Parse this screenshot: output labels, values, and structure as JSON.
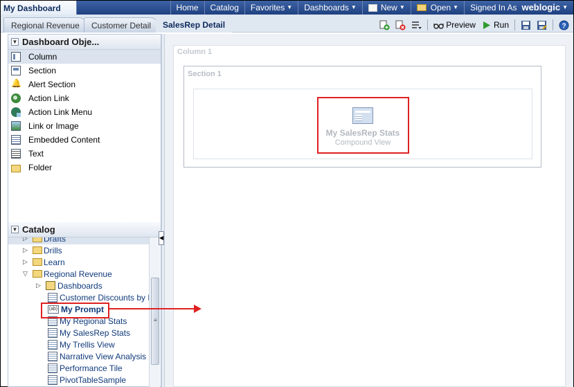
{
  "app": {
    "title": "My Dashboard"
  },
  "top_nav": {
    "home": "Home",
    "catalog": "Catalog",
    "favorites": "Favorites",
    "dashboards": "Dashboards",
    "new": "New",
    "open": "Open",
    "signed_in_as": "Signed In As",
    "user": "weblogic"
  },
  "tabs": [
    {
      "label": "Regional Revenue"
    },
    {
      "label": "Customer Detail"
    },
    {
      "label": "SalesRep Detail",
      "active": true
    }
  ],
  "toolbar": {
    "preview_label": "Preview",
    "run_label": "Run",
    "help_label": "?"
  },
  "dashboard_objects": {
    "header": "Dashboard Obje...",
    "items": [
      {
        "label": "Column",
        "icon": "column-icon"
      },
      {
        "label": "Section",
        "icon": "section-icon"
      },
      {
        "label": "Alert Section",
        "icon": "bell-icon"
      },
      {
        "label": "Action Link",
        "icon": "action-link-icon"
      },
      {
        "label": "Action Link Menu",
        "icon": "action-link-menu-icon"
      },
      {
        "label": "Link or Image",
        "icon": "image-icon"
      },
      {
        "label": "Embedded Content",
        "icon": "embedded-content-icon"
      },
      {
        "label": "Text",
        "icon": "text-icon"
      },
      {
        "label": "Folder",
        "icon": "folder-icon"
      }
    ]
  },
  "catalog": {
    "header": "Catalog",
    "items": [
      {
        "label": "Drafts",
        "type": "folder",
        "expanded": false
      },
      {
        "label": "Drills",
        "type": "folder",
        "expanded": false
      },
      {
        "label": "Learn",
        "type": "folder",
        "expanded": false
      },
      {
        "label": "Regional Revenue",
        "type": "folder",
        "expanded": true
      },
      {
        "label": "Dashboards",
        "type": "dashboards",
        "expanded": false
      },
      {
        "label": "Customer Discounts by Re",
        "type": "analysis"
      },
      {
        "label": "My Prompt",
        "type": "prompt",
        "prompt_badge": "(ab)"
      },
      {
        "label": "My Regional Stats",
        "type": "analysis"
      },
      {
        "label": "My SalesRep Stats",
        "type": "analysis"
      },
      {
        "label": "My Trellis View",
        "type": "analysis"
      },
      {
        "label": "Narrative View Analysis",
        "type": "analysis"
      },
      {
        "label": "Performance Tile",
        "type": "analysis"
      },
      {
        "label": "PivotTableSample",
        "type": "analysis"
      }
    ]
  },
  "canvas": {
    "column_label": "Column 1",
    "section_label": "Section 1",
    "view": {
      "title": "My SalesRep Stats",
      "subtitle": "Compound View"
    }
  },
  "colors": {
    "topbar": "#2a4e8c",
    "annotation": "#e02020",
    "link": "#0f3a7a"
  }
}
